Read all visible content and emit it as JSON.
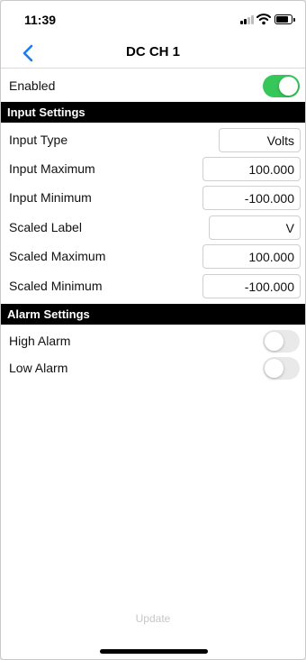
{
  "status_bar": {
    "time": "11:39"
  },
  "nav": {
    "title": "DC CH 1"
  },
  "enabled": {
    "label": "Enabled",
    "value": true
  },
  "input_settings": {
    "header": "Input Settings",
    "rows": [
      {
        "label": "Input Type",
        "value": "Volts"
      },
      {
        "label": "Input Maximum",
        "value": "100.000"
      },
      {
        "label": "Input Minimum",
        "value": "-100.000"
      },
      {
        "label": "Scaled Label",
        "value": "V"
      },
      {
        "label": "Scaled Maximum",
        "value": "100.000"
      },
      {
        "label": "Scaled Minimum",
        "value": "-100.000"
      }
    ]
  },
  "alarm_settings": {
    "header": "Alarm Settings",
    "high_alarm": {
      "label": "High Alarm",
      "value": false
    },
    "low_alarm": {
      "label": "Low Alarm",
      "value": false
    }
  },
  "footer": {
    "update_label": "Update"
  },
  "colors": {
    "toggle_on": "#35c759",
    "accent": "#1a7cf2",
    "section_bg": "#000000"
  },
  "icons": {
    "back": "chevron-left-icon",
    "signal": "cellular-signal-icon",
    "wifi": "wifi-icon",
    "battery": "battery-icon"
  }
}
